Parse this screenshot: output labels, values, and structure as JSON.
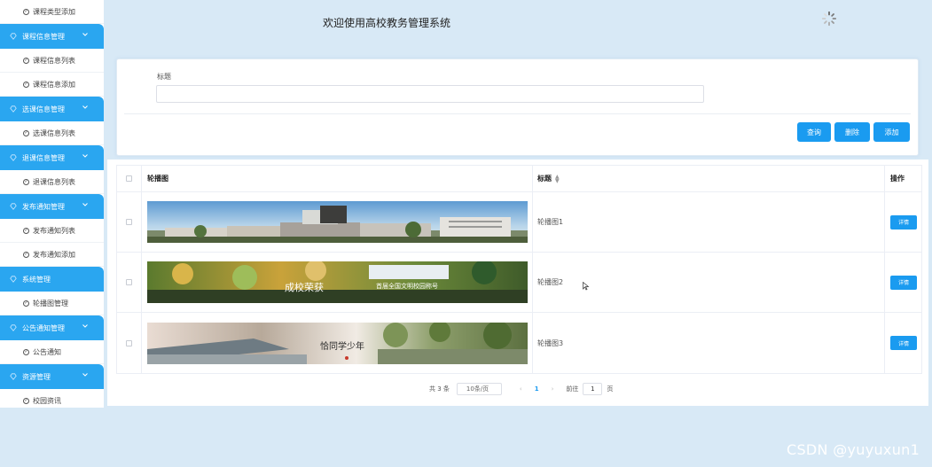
{
  "app": {
    "title": "欢迎使用高校教务管理系统"
  },
  "sidebar": {
    "items": [
      {
        "type": "sub",
        "label": "课程类型添加"
      },
      {
        "type": "group",
        "label": "课程信息管理"
      },
      {
        "type": "sub",
        "label": "课程信息列表"
      },
      {
        "type": "sub",
        "label": "课程信息添加"
      },
      {
        "type": "group",
        "label": "选课信息管理"
      },
      {
        "type": "sub",
        "label": "选课信息列表"
      },
      {
        "type": "group",
        "label": "退课信息管理"
      },
      {
        "type": "sub",
        "label": "退课信息列表"
      },
      {
        "type": "group",
        "label": "发布通知管理"
      },
      {
        "type": "sub",
        "label": "发布通知列表"
      },
      {
        "type": "sub",
        "label": "发布通知添加"
      },
      {
        "type": "group",
        "label": "系统管理"
      },
      {
        "type": "sub",
        "label": "轮播图管理"
      },
      {
        "type": "group",
        "label": "公告通知管理"
      },
      {
        "type": "sub",
        "label": "公告通知"
      },
      {
        "type": "group",
        "label": "资源管理"
      },
      {
        "type": "sub",
        "label": "校园资讯"
      }
    ]
  },
  "search": {
    "label": "标题",
    "value": "",
    "placeholder": "",
    "query_label": "查询",
    "delete_label": "删除",
    "add_label": "添加"
  },
  "table": {
    "columns": {
      "image": "轮播图",
      "title": "标题",
      "ops": "操作"
    },
    "rows": [
      {
        "title": "轮播图1",
        "detail_label": "详情"
      },
      {
        "title": "轮播图2",
        "detail_label": "详情"
      },
      {
        "title": "轮播图3",
        "detail_label": "详情"
      }
    ]
  },
  "banners": {
    "b2_calligraphy": "成校荣获",
    "b2_caption": "首届全国文明校园称号",
    "b3_calligraphy": "恰同学少年"
  },
  "pagination": {
    "total": "共 3 条",
    "page_size": "10条/页",
    "current_page": "1",
    "goto_prefix": "前往",
    "goto_value": "1",
    "goto_suffix": "页"
  },
  "watermark": "CSDN @yuyuxun1",
  "colors": {
    "primary": "#1a9bf0",
    "nav_group": "#2aa6f0",
    "background": "#d8e9f6"
  }
}
